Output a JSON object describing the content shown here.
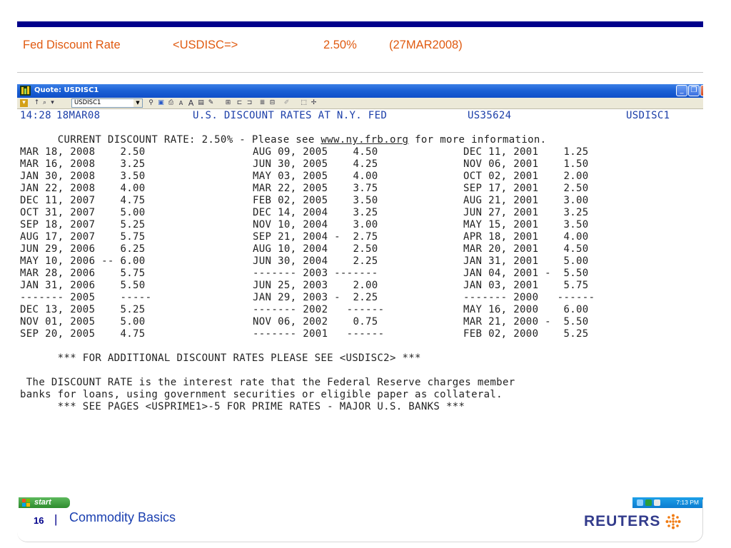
{
  "header": {
    "label": "Fed Discount Rate",
    "ric": "<USDISC=>",
    "rate": "2.50%",
    "date": "(27MAR2008)"
  },
  "window": {
    "title": "Quote: USDISC1",
    "toolbar_ric": "USDISC1",
    "buttons": [
      "minimize",
      "restore",
      "close"
    ]
  },
  "quote": {
    "time": "14:28",
    "date": "18MAR08",
    "title": "U.S. DISCOUNT RATES AT N.Y. FED",
    "code": "US35624",
    "page": "USDISC1",
    "current_prefix": "CURRENT DISCOUNT RATE: 2.50% - Please see ",
    "current_link": "www.ny.frb.org",
    "current_suffix": " for more information.",
    "rows": [
      [
        "MAR 18, 2008    2.50",
        "AUG 09, 2005    4.50",
        "DEC 11, 2001    1.25"
      ],
      [
        "MAR 16, 2008    3.25",
        "JUN 30, 2005    4.25",
        "NOV 06, 2001    1.50"
      ],
      [
        "JAN 30, 2008    3.50",
        "MAY 03, 2005    4.00",
        "OCT 02, 2001    2.00"
      ],
      [
        "JAN 22, 2008    4.00",
        "MAR 22, 2005    3.75",
        "SEP 17, 2001    2.50"
      ],
      [
        "DEC 11, 2007    4.75",
        "FEB 02, 2005    3.50",
        "AUG 21, 2001    3.00"
      ],
      [
        "OCT 31, 2007    5.00",
        "DEC 14, 2004    3.25",
        "JUN 27, 2001    3.25"
      ],
      [
        "SEP 18, 2007    5.25",
        "NOV 10, 2004    3.00",
        "MAY 15, 2001    3.50"
      ],
      [
        "AUG 17, 2007    5.75",
        "SEP 21, 2004 -  2.75",
        "APR 18, 2001    4.00"
      ],
      [
        "JUN 29, 2006    6.25",
        "AUG 10, 2004    2.50",
        "MAR 20, 2001    4.50"
      ],
      [
        "MAY 10, 2006 -- 6.00",
        "JUN 30, 2004    2.25",
        "JAN 31, 2001    5.00"
      ],
      [
        "MAR 28, 2006    5.75",
        "------- 2003 -------",
        "JAN 04, 2001 -  5.50"
      ],
      [
        "JAN 31, 2006    5.50",
        "JUN 25, 2003    2.00",
        "JAN 03, 2001    5.75"
      ],
      [
        "------- 2005    -----",
        "JAN 29, 2003 -  2.25",
        "------- 2000   ------"
      ],
      [
        "DEC 13, 2005    5.25",
        "------- 2002   ------",
        "MAY 16, 2000    6.00"
      ],
      [
        "NOV 01, 2005    5.00",
        "NOV 06, 2002    0.75",
        "MAR 21, 2000 -  5.50"
      ],
      [
        "SEP 20, 2005    4.75",
        "------- 2001   ------",
        "FEB 02, 2000    5.25"
      ]
    ],
    "additional_note": "      *** FOR ADDITIONAL DISCOUNT RATES PLEASE SEE <USDISC2> ***",
    "definition_line1": " The DISCOUNT RATE is the interest rate that the Federal Reserve charges member",
    "definition_line2": "banks for loans, using government securities or eligible paper as collateral.",
    "prime_note": "      *** SEE PAGES <USPRIME1>-5 FOR PRIME RATES - MAJOR U.S. BANKS ***"
  },
  "taskbar": {
    "start_label": "start",
    "clock": "7:13 PM"
  },
  "footer": {
    "page_number": "16",
    "separator": "|",
    "title": "Commodity Basics",
    "logo_text": "REUTERS"
  },
  "colors": {
    "accent_orange": "#E05A10",
    "navy": "#00008B",
    "quote_blue": "#1b3ea8",
    "titlebar_blue": "#1a5fd4"
  }
}
